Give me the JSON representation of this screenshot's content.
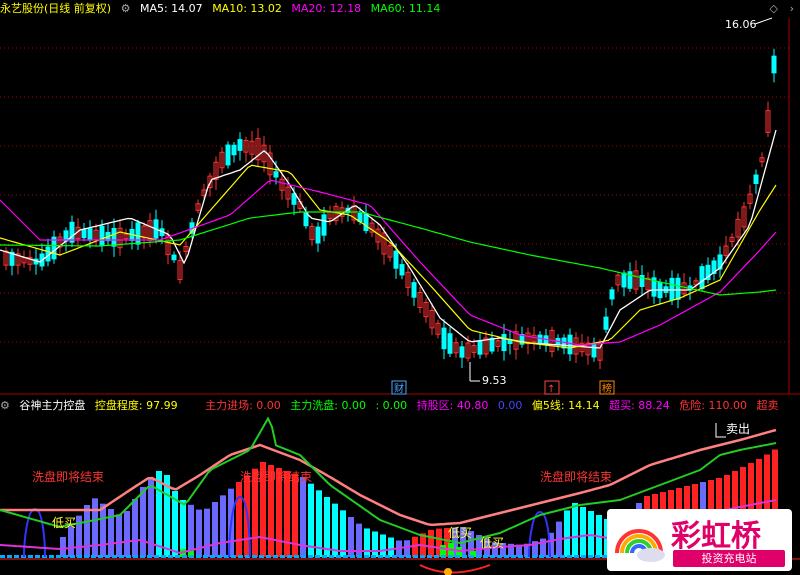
{
  "main_panel": {
    "stock_title": "永艺股份(日线 前复权)",
    "ma": [
      {
        "label": "MA5: 14.07",
        "color": "#ffffff"
      },
      {
        "label": "MA10: 13.02",
        "color": "#ffff00"
      },
      {
        "label": "MA20: 12.18",
        "color": "#ff00ff"
      },
      {
        "label": "MA60: 11.14",
        "color": "#00ff00"
      }
    ],
    "price_high_label": "16.06",
    "price_low_label": "9.53",
    "event_badges": [
      {
        "text": "财",
        "color": "#4da6ff"
      },
      {
        "text": "↑",
        "color": "#ff4444"
      },
      {
        "text": "榜",
        "color": "#ff8800"
      }
    ]
  },
  "indicator_panel": {
    "name": "谷神主力控盘",
    "values": [
      {
        "label": "控盘程度: 97.99",
        "color": "#ffff00"
      },
      {
        "label": "主力进场: 0.00",
        "color": "#ff3333"
      },
      {
        "label": "主力洗盘: 0.00",
        "color": "#00ff00"
      },
      {
        "label": ": 0.00",
        "color": "#00ff00"
      },
      {
        "label": "持股区: 40.80",
        "color": "#ff00ff"
      },
      {
        "label": "0.00",
        "color": "#4444ff"
      },
      {
        "label": "偏5线: 14.14",
        "color": "#ffff00"
      },
      {
        "label": "超买: 88.24",
        "color": "#ff00ff"
      },
      {
        "label": "危险: 110.00",
        "color": "#ff3333"
      },
      {
        "label": "超卖",
        "color": "#ff3333"
      }
    ],
    "annotations": {
      "wash_end": "洗盘即将结束",
      "low_buy": "低买",
      "sell": "卖出"
    }
  },
  "colors": {
    "up": "#ff3333",
    "down": "#00ffff",
    "ma5": "#ffffff",
    "ma10": "#ffff00",
    "ma20": "#ff00ff",
    "ma60": "#00ff00",
    "grid": "#aa0000",
    "bar_blue": "#6a6aff",
    "bar_cyan": "#00ffff",
    "bar_red": "#ff2222"
  },
  "watermark": {
    "brand": "彩虹桥",
    "slogan": "投资充电站"
  }
}
